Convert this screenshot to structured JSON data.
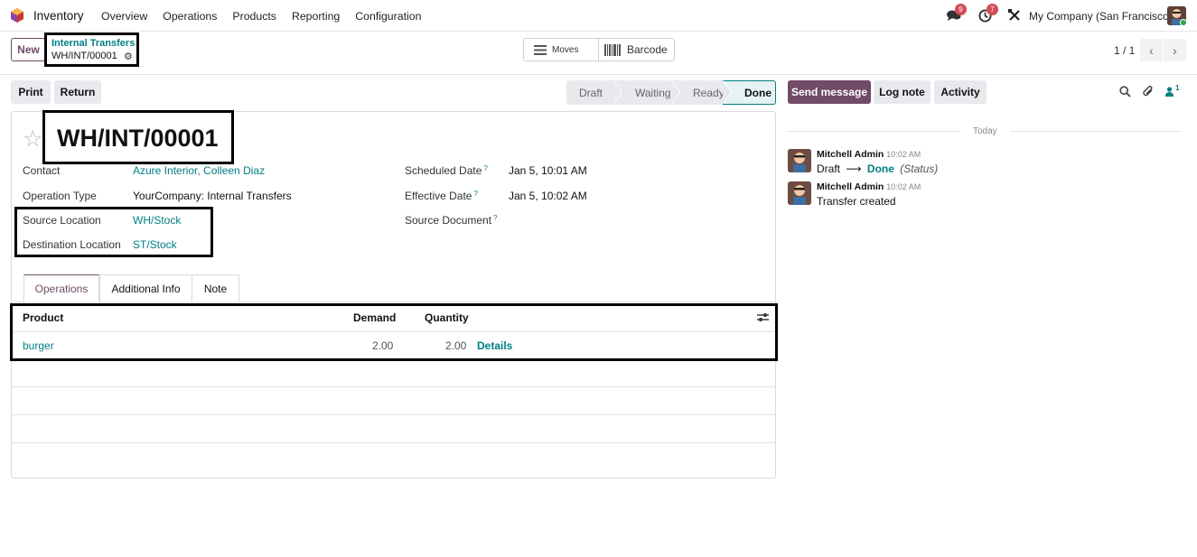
{
  "nav": {
    "app_name": "Inventory",
    "menu": [
      "Overview",
      "Operations",
      "Products",
      "Reporting",
      "Configuration"
    ],
    "messages_count": "9",
    "activities_count": "7",
    "company": "My Company (San Francisco)"
  },
  "control": {
    "new_label": "New",
    "breadcrumb_parent": "Internal Transfers",
    "breadcrumb_current": "WH/INT/00001",
    "moves_label": "Moves",
    "barcode_label": "Barcode",
    "pager": "1 / 1"
  },
  "actions": {
    "print_label": "Print",
    "return_label": "Return",
    "stages": [
      "Draft",
      "Waiting",
      "Ready",
      "Done"
    ],
    "current_stage": "Done"
  },
  "form": {
    "title": "WH/INT/00001",
    "contact_label": "Contact",
    "contact_value": "Azure Interior, Colleen Diaz",
    "operation_type_label": "Operation Type",
    "operation_type_value": "YourCompany: Internal Transfers",
    "source_location_label": "Source Location",
    "source_location_value": "WH/Stock",
    "destination_location_label": "Destination Location",
    "destination_location_value": "ST/Stock",
    "scheduled_date_label": "Scheduled Date",
    "scheduled_date_value": "Jan 5, 10:01 AM",
    "effective_date_label": "Effective Date",
    "effective_date_value": "Jan 5, 10:02 AM",
    "source_document_label": "Source Document",
    "help_mark": "?"
  },
  "tabs": [
    "Operations",
    "Additional Info",
    "Note"
  ],
  "table": {
    "headers": {
      "product": "Product",
      "demand": "Demand",
      "quantity": "Quantity"
    },
    "rows": [
      {
        "product": "burger",
        "demand": "2.00",
        "quantity": "2.00",
        "details": "Details"
      }
    ]
  },
  "chatter": {
    "send_message_label": "Send message",
    "log_note_label": "Log note",
    "activity_label": "Activity",
    "followers_count": "1",
    "today_label": "Today",
    "messages": [
      {
        "author": "Mitchell Admin",
        "time": "10:02 AM",
        "from": "Draft",
        "to": "Done",
        "field": "(Status)"
      },
      {
        "author": "Mitchell Admin",
        "time": "10:02 AM",
        "text": "Transfer created"
      }
    ]
  },
  "colors": {
    "brand": "#714b67",
    "link": "#017e84"
  }
}
